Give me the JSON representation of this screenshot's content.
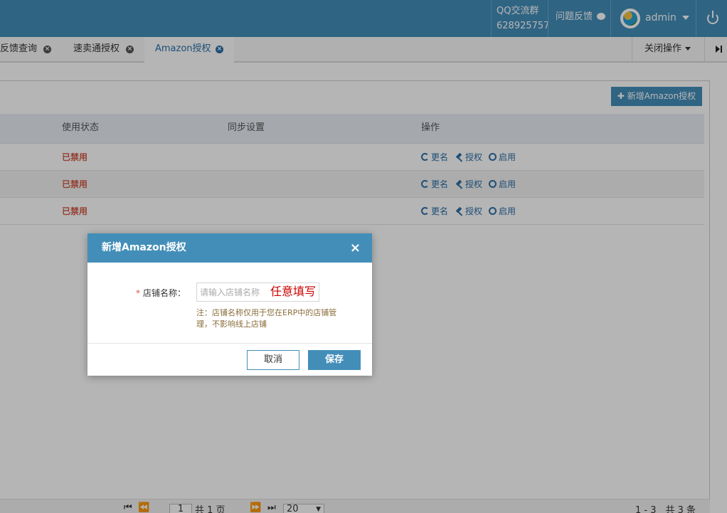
{
  "topbar": {
    "qq_label": "QQ交流群",
    "qq_number": "628925757",
    "feedback": "问题反馈",
    "user": "admin"
  },
  "tabs": [
    {
      "label": "反馈查询"
    },
    {
      "label": "速卖通授权"
    },
    {
      "label": "Amazon授权"
    }
  ],
  "close_ops": "关闭操作",
  "toolbar": {
    "add_label": "新增Amazon授权"
  },
  "table": {
    "headers": [
      "使用状态",
      "同步设置",
      "操作"
    ],
    "rows": [
      {
        "status": "已禁用",
        "actions": [
          "更名",
          "授权",
          "启用"
        ]
      },
      {
        "status": "已禁用",
        "actions": [
          "更名",
          "授权",
          "启用"
        ]
      },
      {
        "status": "已禁用",
        "actions": [
          "更名",
          "授权",
          "启用"
        ]
      }
    ]
  },
  "pager": {
    "page_value": "1",
    "total_pages": "共 1 页",
    "page_size": "20",
    "summary": "1 - 3　共 3 条"
  },
  "dialog": {
    "title": "新增Amazon授权",
    "close": "×",
    "label": "店铺名称：",
    "required_mark": "*",
    "placeholder": "请输入店铺名称",
    "annotation": "任意填写",
    "note": "注：店铺名称仅用于您在ERP中的店铺管理，不影响线上店铺",
    "cancel": "取消",
    "save": "保存"
  },
  "colors": {
    "primary": "#438eb9",
    "danger": "#d15b47",
    "link": "#2b6fa7",
    "note": "#8a6d3b"
  }
}
